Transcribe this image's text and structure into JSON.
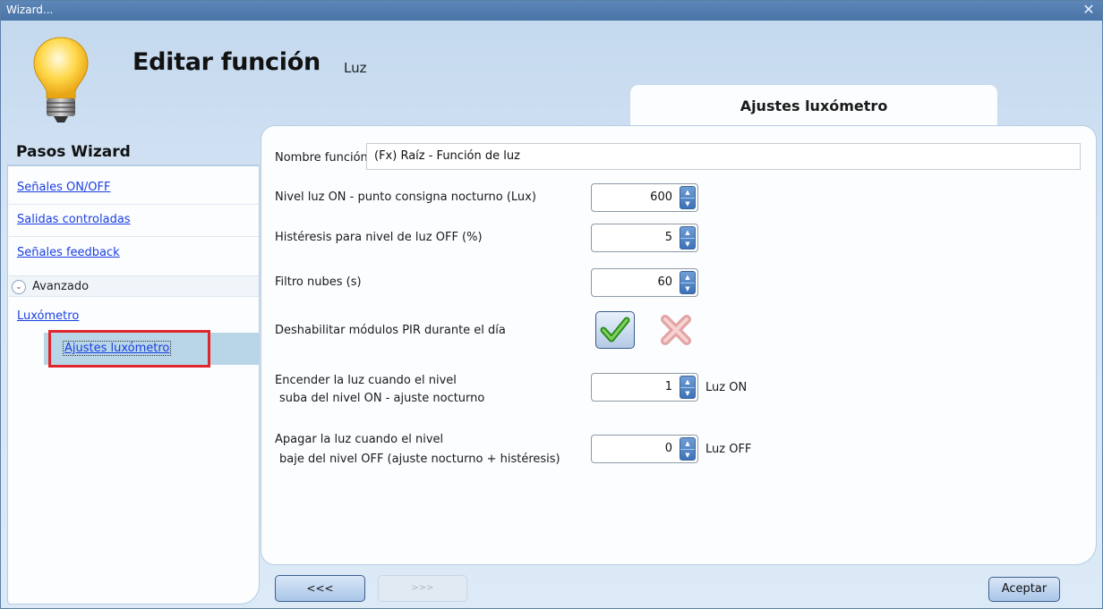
{
  "window": {
    "title": "Wizard...",
    "close_glyph": "✕"
  },
  "header": {
    "title": "Editar función",
    "subtitle": "Luz",
    "icon": "lightbulb-icon"
  },
  "tab": {
    "label": "Ajustes luxómetro"
  },
  "steps": {
    "title": "Pasos Wizard",
    "items": [
      "Señales ON/OFF",
      "Salidas controladas",
      "Señales feedback"
    ],
    "advanced": {
      "label": "Avanzado",
      "icon": "chevron-down-circle-icon"
    },
    "group": "Luxómetro",
    "selected_substep": "Ajustes luxómetro"
  },
  "form": {
    "name_label": "Nombre función:",
    "name_value": "(Fx) Raíz - Función de luz",
    "on_level_label": "Nivel luz ON - punto consigna nocturno (Lux)",
    "on_level_value": "600",
    "hysteresis_label": "Histéresis para nivel de luz OFF (%)",
    "hysteresis_value": "5",
    "cloud_filter_label": "Filtro nubes (s)",
    "cloud_filter_value": "60",
    "disable_pir_label": "Deshabilitar módulos PIR durante el día",
    "disable_pir_selected": "check",
    "turn_on_label_line1": "Encender la luz cuando el nivel",
    "turn_on_label_line2": "suba del nivel ON - ajuste nocturno",
    "turn_on_value": "1",
    "turn_on_unit": "Luz ON",
    "turn_off_label_line1": "Apagar la luz cuando el nivel",
    "turn_off_label_line2": "baje del nivel OFF (ajuste nocturno + histéresis)",
    "turn_off_value": "0",
    "turn_off_unit": "Luz OFF"
  },
  "footer": {
    "back_label": "<<<",
    "forward_label": ">>>",
    "accept_label": "Aceptar"
  },
  "colors": {
    "link": "#1b3fe0",
    "highlight_box": "#e0262c",
    "selected_row": "#b8d6e8",
    "titlebar": "#4a73a6"
  }
}
